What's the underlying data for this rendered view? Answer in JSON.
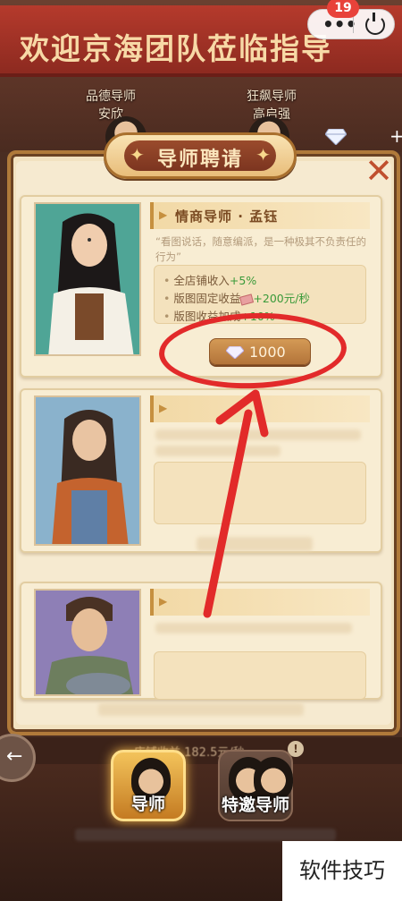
{
  "header": {
    "banner_text": "欢迎京海团队莅临指导",
    "notification_count": "19",
    "mentors": [
      {
        "title": "品德导师",
        "name": "安欣"
      },
      {
        "title": "狂飙导师",
        "name": "高启强"
      }
    ]
  },
  "dialog": {
    "title": "导师聘请",
    "cards": [
      {
        "name": "情商导师 · 孟钰",
        "quote": "“看图说话，随意编派，是一种极其不负责任的行为”",
        "bonuses": [
          {
            "label": "全店铺收入",
            "value": "+5%"
          },
          {
            "label": "版图固定收益",
            "value": "+200元/秒"
          },
          {
            "label": "版图收益加成",
            "value": "+10%"
          }
        ],
        "cost": "1000"
      }
    ]
  },
  "bottom": {
    "income_label": "店铺收益 182.5元/秒",
    "tabs": [
      {
        "label": "导师",
        "active": true
      },
      {
        "label": "特邀导师",
        "active": false
      }
    ]
  },
  "watermark": "软件技巧",
  "colors": {
    "annotation_red": "#e22a2a",
    "bonus_green": "#3a9a3a"
  }
}
